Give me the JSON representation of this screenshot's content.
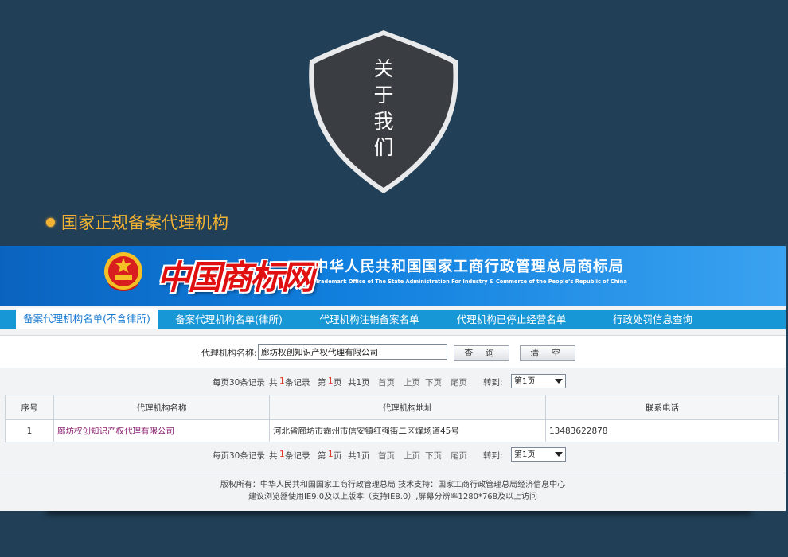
{
  "page_title": {
    "chars": [
      "关",
      "于",
      "我",
      "们"
    ]
  },
  "section_heading": "国家正规备案代理机构",
  "site": {
    "logo_text": "中国商标网",
    "title": "中华人民共和国国家工商行政管理总局商标局",
    "subtitle": "Trademark Office of The State Administration For Industry & Commerce of the People’s Republic of China"
  },
  "nav": {
    "tabs": [
      {
        "label": "备案代理机构名单(不含律所)",
        "active": true
      },
      {
        "label": "备案代理机构名单(律所)",
        "active": false
      },
      {
        "label": "代理机构注销备案名单",
        "active": false
      },
      {
        "label": "代理机构已停止经营名单",
        "active": false
      },
      {
        "label": "行政处罚信息查询",
        "active": false
      }
    ]
  },
  "search": {
    "label": "代理机构名称:",
    "value": "廊坊权创知识产权代理有限公司",
    "query_button": "查 询",
    "clear_button": "清 空"
  },
  "pager": {
    "per_page": "每页30条记录",
    "total_prefix": "共",
    "total_count": "1",
    "total_suffix": "条记录",
    "page_prefix": "第",
    "current_page": "1",
    "page_suffix": "页",
    "total_pages": "共1页",
    "first": "首页",
    "prev": "上页",
    "next": "下页",
    "last": "尾页",
    "goto_label": "转到:",
    "select_value": "第1页"
  },
  "table": {
    "headers": [
      "序号",
      "代理机构名称",
      "代理机构地址",
      "联系电话"
    ],
    "rows": [
      {
        "index": "1",
        "name": "廊坊权创知识产权代理有限公司",
        "address": "河北省廊坊市霸州市信安镇红强街二区煤场道45号",
        "phone": "13483622878"
      }
    ]
  },
  "footer": {
    "line1": "版权所有：中华人民共和国国家工商行政管理总局  技术支持：国家工商行政管理总局经济信息中心",
    "line2": "建议浏览器使用IE9.0及以上版本（支持IE8.0）,屏幕分辨率1280*768及以上访问"
  },
  "colors": {
    "background": "#213f56",
    "accent": "#f2b233",
    "shield": "#3a3d42",
    "nav_blue": "#1797d6",
    "banner_blue": "#1180de"
  }
}
